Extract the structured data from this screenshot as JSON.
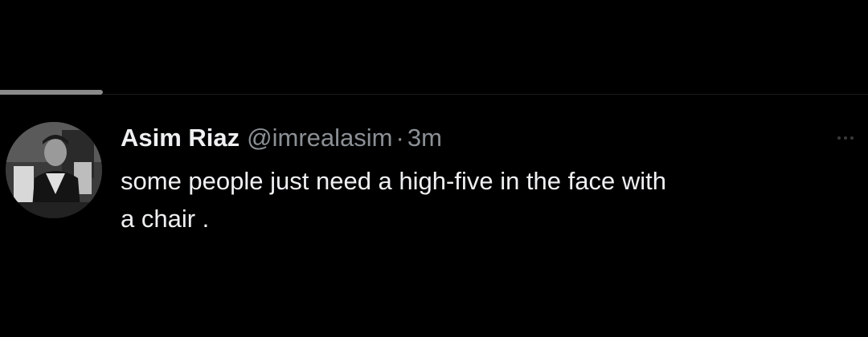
{
  "tweet": {
    "display_name": "Asim Riaz",
    "handle": "@imrealasim",
    "separator": "·",
    "timestamp": "3m",
    "text": "some people just need a high-five in the face with\na chair .",
    "avatar_icon": "user-avatar-photo",
    "more_icon": "more-options-icon"
  },
  "colors": {
    "background": "#000000",
    "primary_text": "#eef0f1",
    "secondary_text": "#8b9095",
    "tab_indicator": "#8a8a8a"
  }
}
